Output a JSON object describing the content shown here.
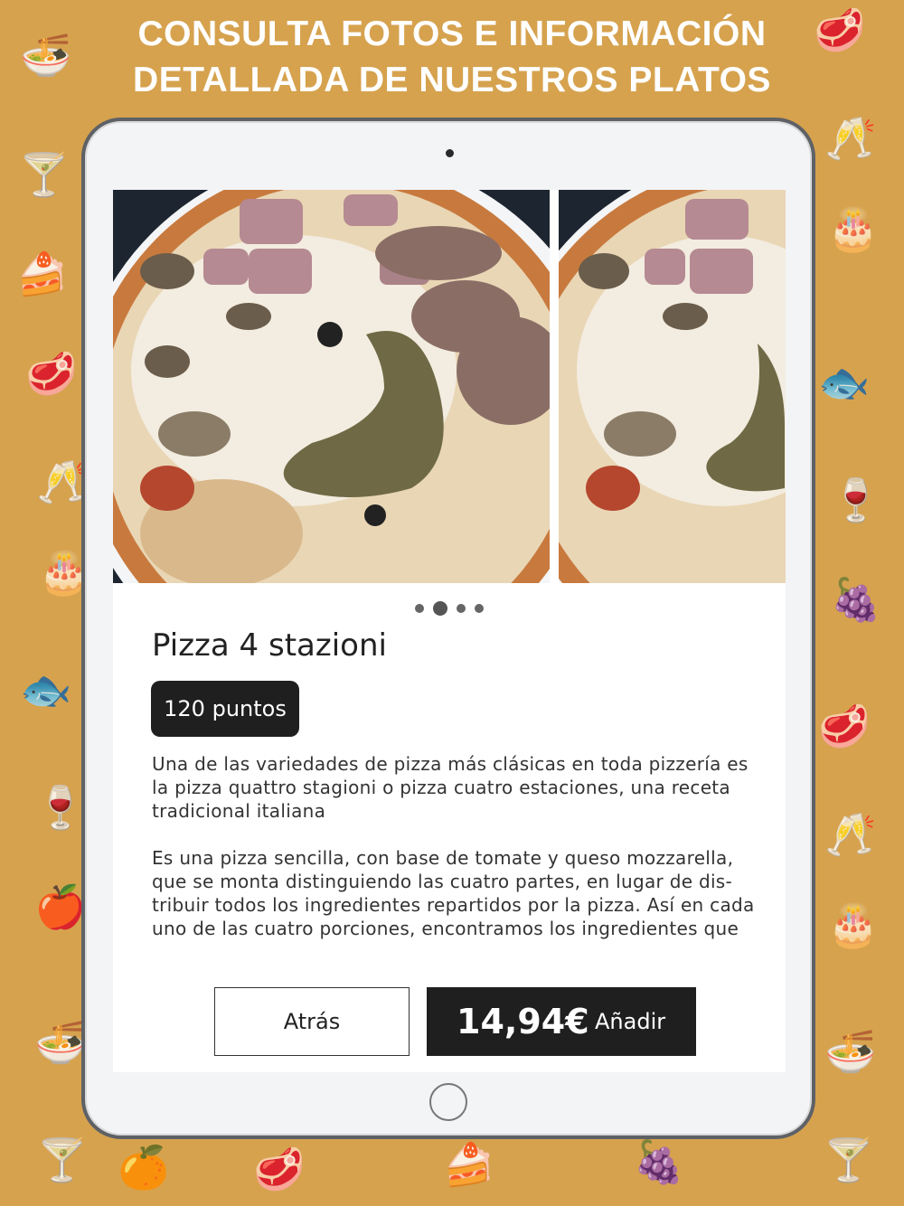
{
  "headline": {
    "line1": "CONSULTA FOTOS E INFORMACIÓN",
    "line2": "DETALLADA DE NUESTROS PLATOS"
  },
  "colors": {
    "background": "#D6A24E",
    "icon_tint": "#F1DDB4",
    "dark_button": "#1f1f1f"
  },
  "decorative_icons": [
    "noodles-icon",
    "steak-icon",
    "cocktail-icon",
    "wine-glasses-icon",
    "cake-icon",
    "fish-icon",
    "wine-bottle-icon",
    "fruit-grapes-icon",
    "citrus-icon"
  ],
  "carousel": {
    "photo_alt": "Pizza 4 stazioni",
    "dot_count": 4,
    "active_dot": 1
  },
  "product": {
    "title": "Pizza 4 stazioni",
    "points_badge": "120 puntos",
    "description_p1": "Una de las variedades de pizza más clásicas en toda pizzería es la pizza quattro stagioni o pizza cuatro estaciones, una receta tradicional italiana",
    "description_p2": "Es una pizza sencilla, con base de tomate y queso mozzarella, que se monta distinguiendo las cuatro partes, en lugar de dis-tribuir todos los ingredientes repartidos por la pizza. Así en cada uno de las cuatro porciones, encontramos los ingredientes que"
  },
  "actions": {
    "back_label": "Atrás",
    "price": "14,94€",
    "add_label": "Añadir"
  }
}
